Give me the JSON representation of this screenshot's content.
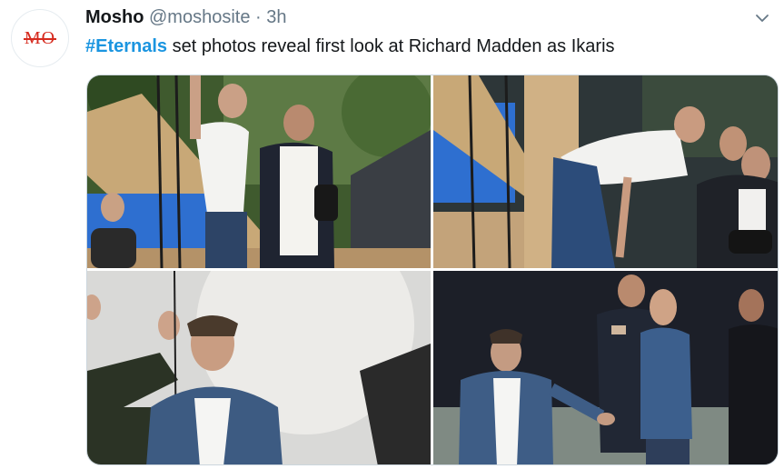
{
  "tweet": {
    "avatar_text": "MO",
    "author_name": "Mosho",
    "author_handle": "@moshosite",
    "separator": "·",
    "time": "3h",
    "hashtag": "#Eternals",
    "body": " set photos reveal first look at Richard Madden as Ikaris",
    "menu_icon": "chevron-down-icon"
  },
  "colors": {
    "link": "#1b95e0",
    "text": "#14171a",
    "muted": "#657786",
    "brand": "#d62a1e"
  }
}
